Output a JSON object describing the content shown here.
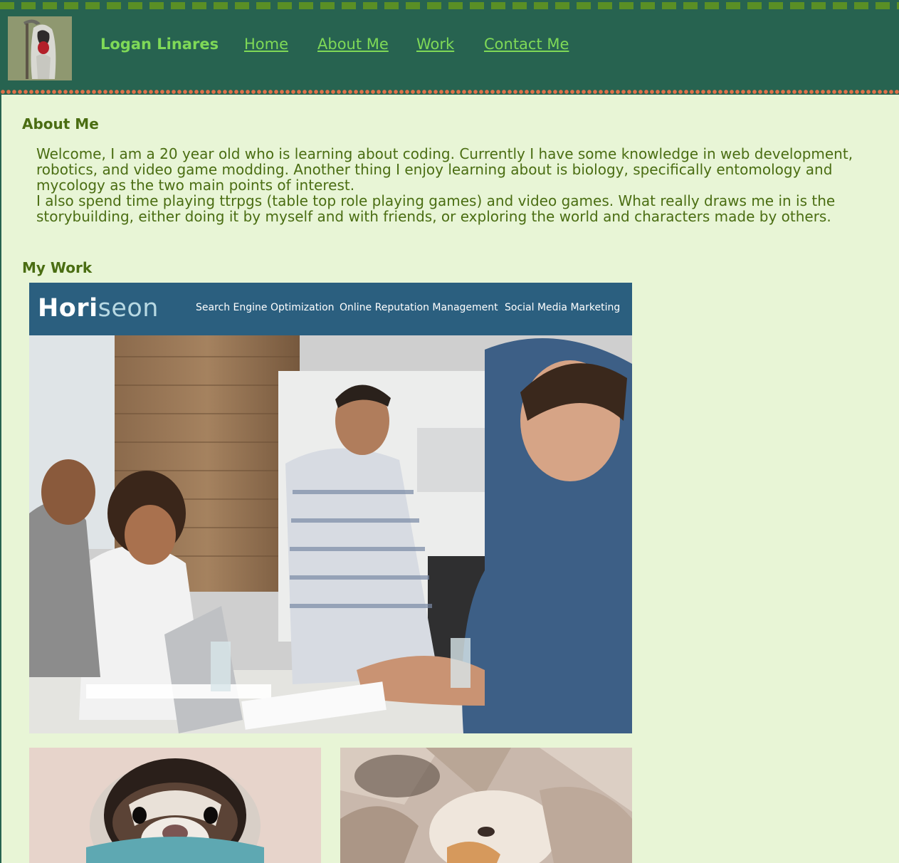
{
  "header": {
    "avatar_alt": "grim reaper avatar",
    "name": "Logan Linares",
    "nav": [
      "Home",
      "About Me",
      "Work",
      "Contact Me"
    ]
  },
  "about": {
    "title": "About Me",
    "paragraphs": [
      "Welcome, I am a 20 year old who is learning about coding. Currently I have some knowledge in web development, robotics, and video game modding. Another thing I enjoy learning about is biology, specifically entomology and mycology as the two main points of interest.",
      "I also spend time playing ttrpgs (table top role playing games) and video games. What really draws me in is the storybuilding, either doing it by myself and with friends, or exploring the world and characters made by others."
    ]
  },
  "work": {
    "title": "My Work",
    "featured": {
      "logo_part1": "Hori",
      "logo_part2": "seon",
      "nav": [
        "Search Engine Optimization",
        "Online Reputation Management",
        "Social Media Marketing"
      ]
    }
  },
  "colors": {
    "header_bg": "#276350",
    "page_bg": "#e8f5d6",
    "link": "#7fd957",
    "heading": "#4a6d12",
    "dot_accent": "#e0714a",
    "horiseon_bar": "#2b5f7f"
  }
}
